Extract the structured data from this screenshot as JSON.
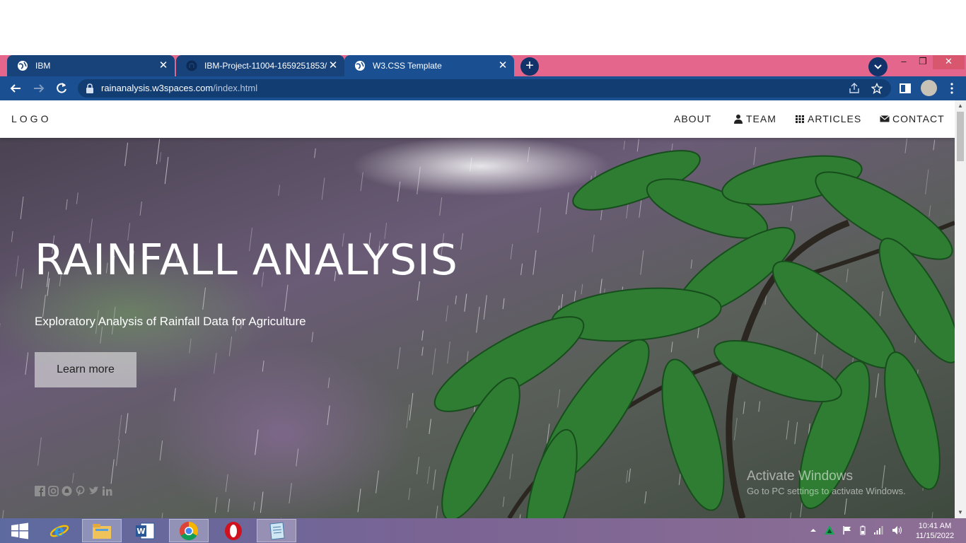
{
  "browser": {
    "tabs": [
      {
        "title": "IBM",
        "icon": "globe-icon"
      },
      {
        "title": "IBM-Project-11004-1659251853/",
        "icon": "github-icon"
      },
      {
        "title": "W3.CSS Template",
        "icon": "globe-icon"
      }
    ],
    "active_tab": 2,
    "url_host": "rainanalysis.w3spaces.com",
    "url_path": "/index.html",
    "colors": {
      "tabstrip": "#e5668c",
      "toolbar": "#1a4f91",
      "inactive_tab": "#18427a"
    }
  },
  "site": {
    "logo": "LOGO",
    "nav": {
      "about": "ABOUT",
      "team": "TEAM",
      "articles": "ARTICLES",
      "contact": "CONTACT"
    },
    "hero": {
      "title": "RAINFALL ANALYSIS",
      "subtitle": "Exploratory Analysis of Rainfall Data for Agriculture",
      "button": "Learn more"
    },
    "social_icons": [
      "facebook-icon",
      "instagram-icon",
      "snapchat-icon",
      "pinterest-icon",
      "twitter-icon",
      "linkedin-icon"
    ]
  },
  "watermark": {
    "title": "Activate Windows",
    "subtitle": "Go to PC settings to activate Windows."
  },
  "taskbar": {
    "apps": [
      "start-icon",
      "internet-explorer-icon",
      "file-explorer-icon",
      "word-icon",
      "chrome-icon",
      "opera-icon",
      "notepad-icon"
    ],
    "active_app": "chrome-icon",
    "time": "10:41 AM",
    "date": "11/15/2022"
  }
}
